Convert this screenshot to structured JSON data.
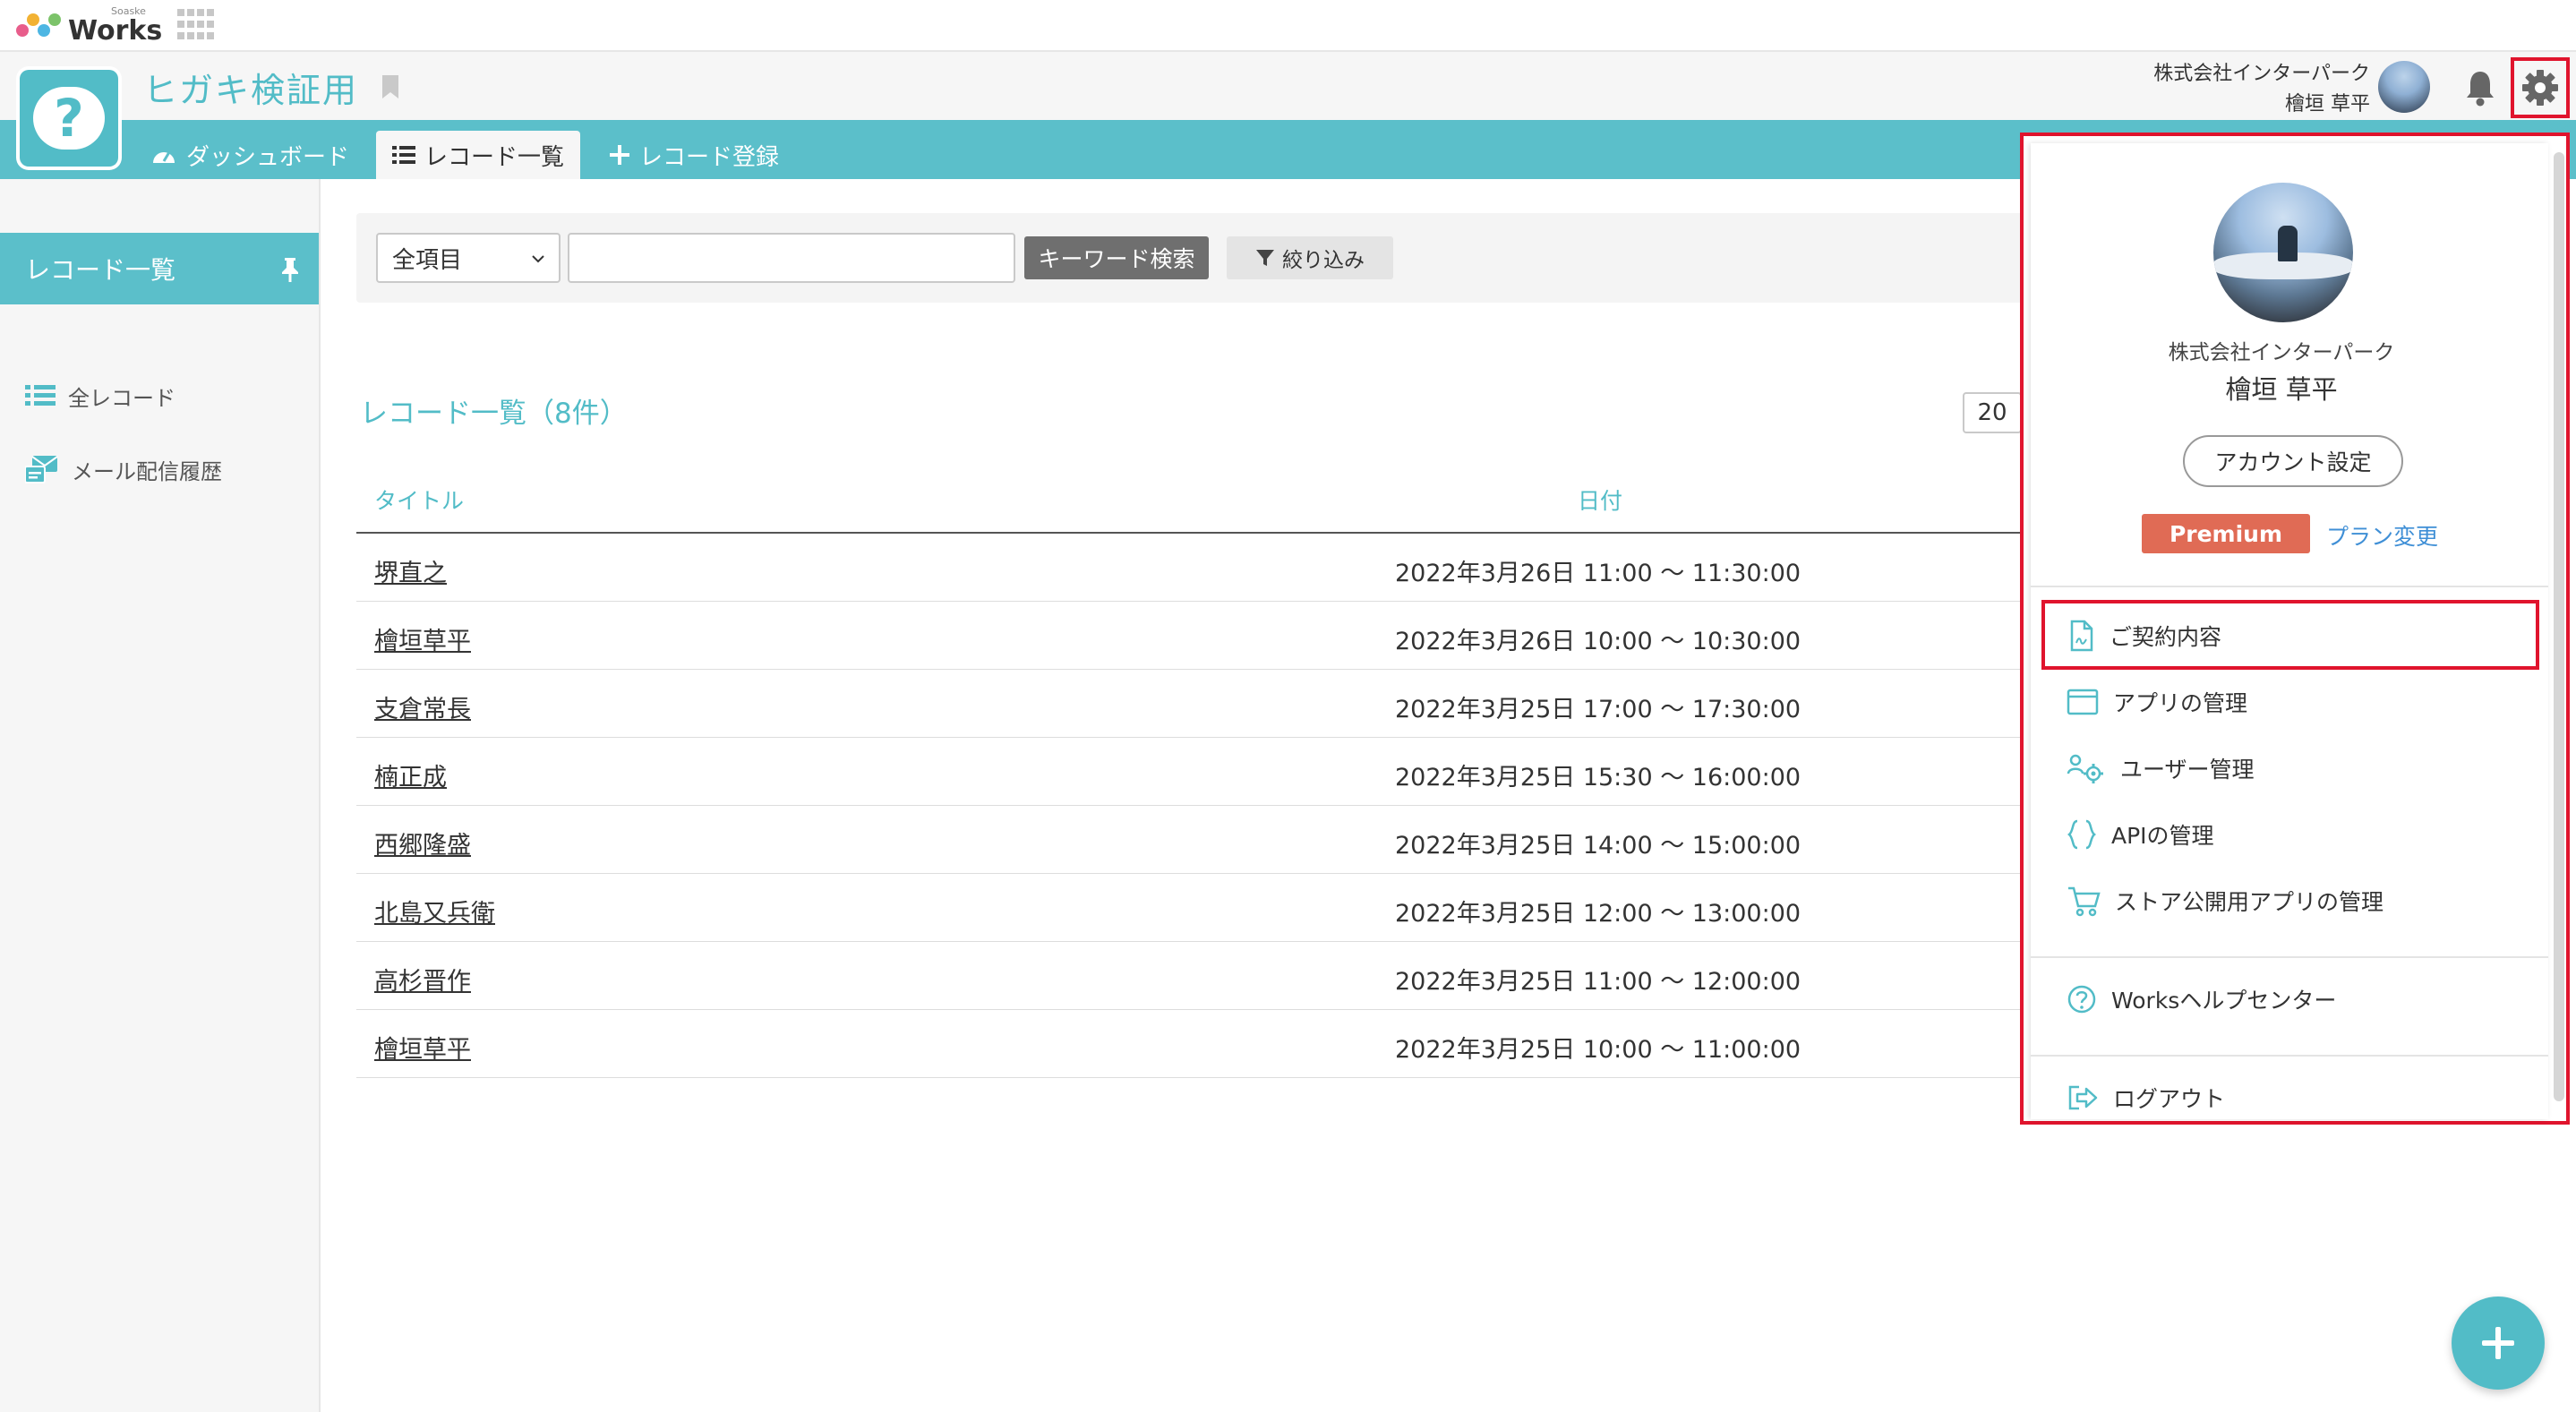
{
  "brand": {
    "sub": "Soaske",
    "name": "Works"
  },
  "app": {
    "title": "ヒガキ検証用"
  },
  "user": {
    "company": "株式会社インターパーク",
    "name": "檜垣 草平"
  },
  "tabs": [
    {
      "label": "ダッシュボード",
      "icon": "dashboard-icon"
    },
    {
      "label": "レコード一覧",
      "icon": "list-icon"
    },
    {
      "label": "レコード登録",
      "icon": "plus-icon"
    }
  ],
  "sidebar": {
    "header": "レコード一覧",
    "items": [
      {
        "label": "全レコード",
        "icon": "list-icon"
      },
      {
        "label": "メール配信履歴",
        "icon": "mail-history-icon"
      }
    ]
  },
  "search": {
    "field_select": "全項目",
    "keyword_value": "",
    "keyword_button": "キーワード検索",
    "filter_button": "絞り込み"
  },
  "list": {
    "heading": "レコード一覧（8件）",
    "per_page": "20",
    "columns": [
      "タイトル",
      "日付"
    ],
    "rows": [
      {
        "title": "堺直之",
        "date": "2022年3月26日 11:00 〜 11:30:00"
      },
      {
        "title": "檜垣草平",
        "date": "2022年3月26日 10:00 〜 10:30:00"
      },
      {
        "title": "支倉常長",
        "date": "2022年3月25日 17:00 〜 17:30:00"
      },
      {
        "title": "楠正成",
        "date": "2022年3月25日 15:30 〜 16:00:00"
      },
      {
        "title": "西郷隆盛",
        "date": "2022年3月25日 14:00 〜 15:00:00"
      },
      {
        "title": "北島又兵衛",
        "date": "2022年3月25日 12:00 〜 13:00:00"
      },
      {
        "title": "高杉晋作",
        "date": "2022年3月25日 11:00 〜 12:00:00"
      },
      {
        "title": "檜垣草平",
        "date": "2022年3月25日 10:00 〜 11:00:00"
      }
    ]
  },
  "dropdown": {
    "company": "株式会社インターパーク",
    "user": "檜垣 草平",
    "account_button": "アカウント設定",
    "plan_badge": "Premium",
    "plan_link": "プラン変更",
    "menu": [
      {
        "label": "ご契約内容",
        "icon": "contract-icon"
      },
      {
        "label": "アプリの管理",
        "icon": "app-window-icon"
      },
      {
        "label": "ユーザー管理",
        "icon": "users-gear-icon"
      },
      {
        "label": "APIの管理",
        "icon": "braces-icon"
      },
      {
        "label": "ストア公開用アプリの管理",
        "icon": "cart-icon"
      }
    ],
    "help": {
      "label": "Worksヘルプセンター",
      "icon": "help-circle-icon"
    },
    "logout": {
      "label": "ログアウト",
      "icon": "logout-icon"
    }
  },
  "colors": {
    "accent": "#5bbfca",
    "highlight": "#e0142d",
    "premium": "#e06b55",
    "link": "#3f8fd6"
  }
}
